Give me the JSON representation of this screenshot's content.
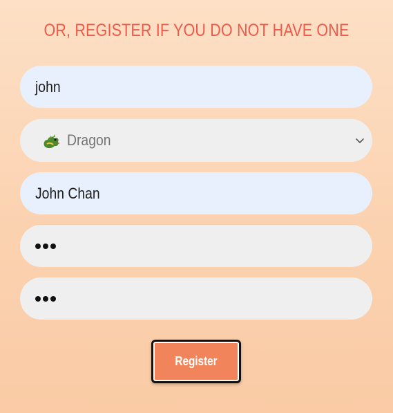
{
  "heading": "OR, REGISTER IF YOU DO NOT HAVE ONE",
  "form": {
    "username_value": "john",
    "zodiac_selected": "Dragon",
    "zodiac_icon": "dragon-emoji-icon",
    "fullname_value": "John Chan",
    "password_mask": "•••",
    "confirm_password_mask": "•••",
    "register_label": "Register"
  },
  "colors": {
    "heading": "#ee5a4a",
    "input_autofill": "#e8f0fe",
    "input_default": "#efefef",
    "button": "#f2845c"
  }
}
